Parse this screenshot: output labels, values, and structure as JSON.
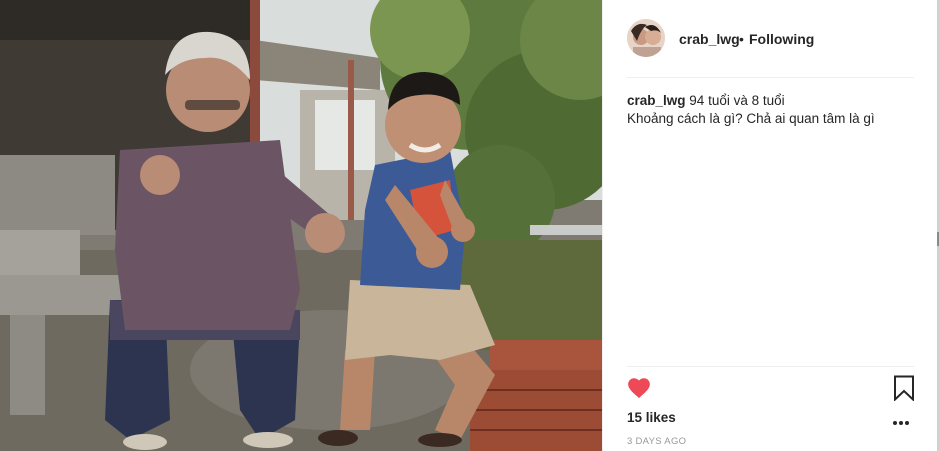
{
  "post": {
    "username": "crab_lwg",
    "separator": "•",
    "follow_status": "Following",
    "caption_user": "crab_lwg",
    "caption_line1": "94 tuổi và 8 tuổi",
    "caption_line2": "Khoảng cách là gì? Chả ai quan tâm là gì",
    "likes": "15 likes",
    "timestamp": "3 DAYS AGO"
  },
  "icons": {
    "like": "heart-icon",
    "save": "bookmark-icon",
    "more": "more-options-icon"
  },
  "colors": {
    "like_red": "#ed4956",
    "text": "#262626",
    "muted": "#999999",
    "divider": "#efefef"
  }
}
